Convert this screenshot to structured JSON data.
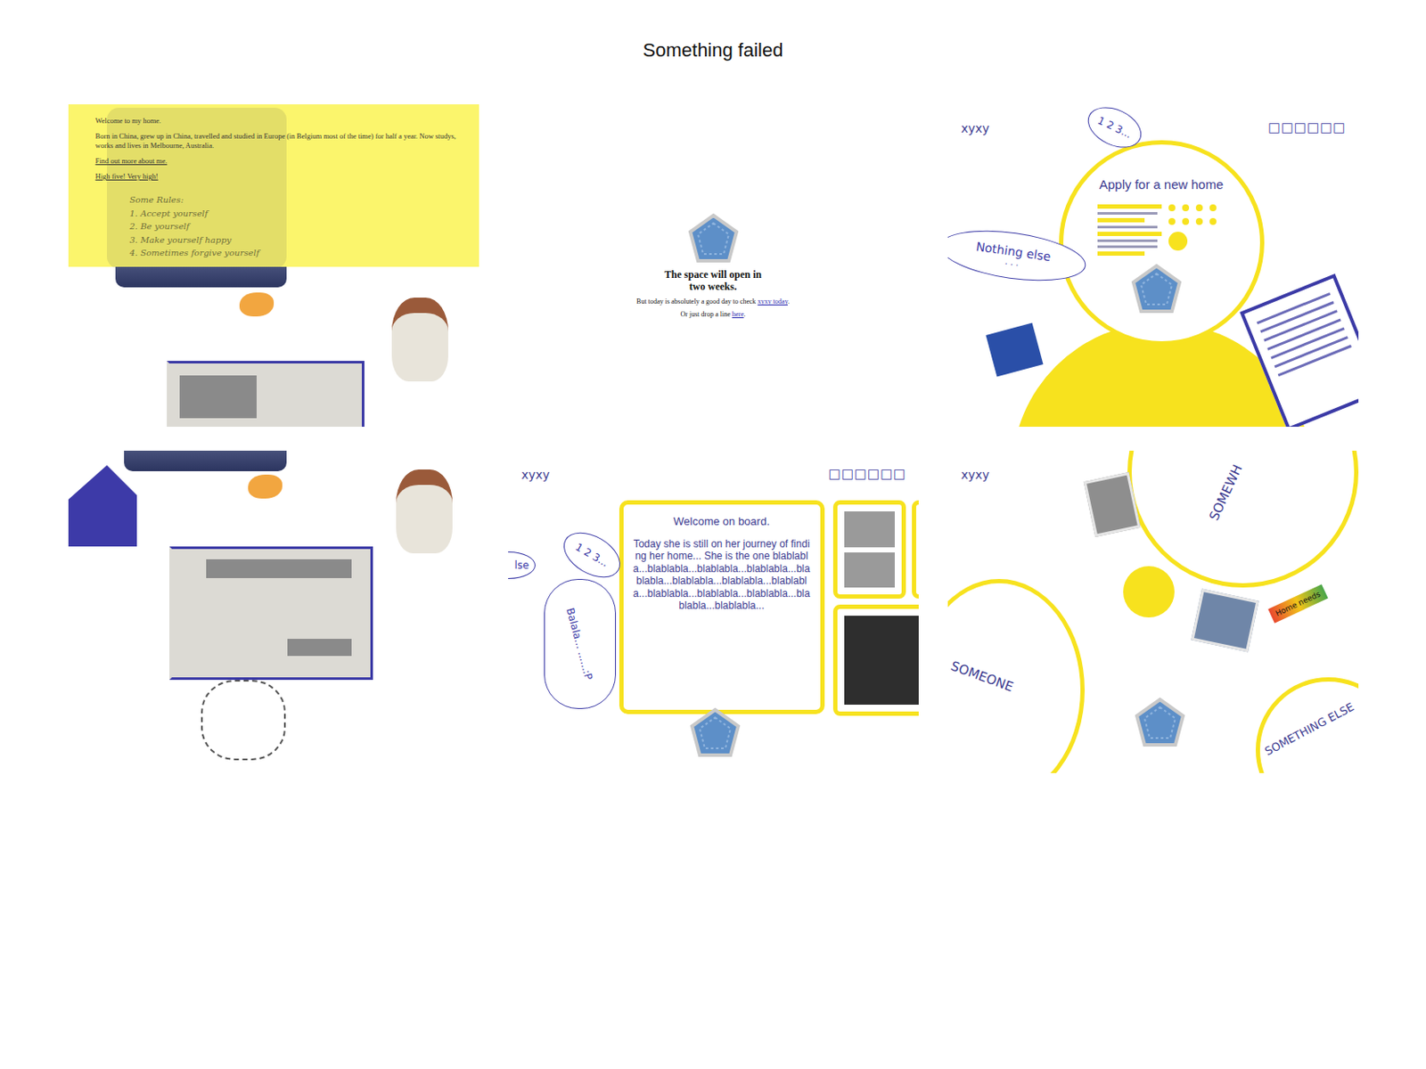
{
  "page": {
    "title": "Something failed"
  },
  "tiles": [
    {
      "kind": "intro",
      "lines": [
        "Welcome to my home.",
        "Born in China, grew up in China, travelled and studied in Europe (in Belgium most of the time) for half a year. Now studys, works and lives in Melbourne, Australia."
      ],
      "links": [
        "Find out more about me.",
        "High five! Very high!"
      ],
      "rules_title": "Some Rules:",
      "rules": [
        "1. Accept yourself",
        "2. Be yourself",
        "3. Make yourself happy",
        "4. Sometimes forgive yourself"
      ]
    },
    {
      "kind": "soon",
      "heading": "The space will open in two weeks.",
      "line_before": "But today is absolutely a good day to check ",
      "link": "xyxy today",
      "line_after": ".",
      "drop_before": "Or just drop a line ",
      "drop_link": "here",
      "drop_after": "."
    },
    {
      "kind": "apply",
      "logo": "xyxy",
      "menu": "□□□□□□",
      "bubble": "1 2 3...",
      "heading": "Apply for a new home",
      "side_bubble": "Nothing else",
      "side_dots": ". . ."
    },
    {
      "kind": "collage"
    },
    {
      "kind": "board",
      "logo": "xyxy",
      "menu": "□□□□□□",
      "bubble": "1 2 3...",
      "tall_bubble": "Balala... ......:P",
      "cut_bubble": "lse",
      "heading": "Welcome on board.",
      "body": "Today she is still on her journey of finding her home... She is the one blablabla...blablabla...blablabla...blablabla...blablabla...blablabla...blablabla...blablabla...blablabla...blablabla...blablabla...blablabla...blablabla..."
    },
    {
      "kind": "circles",
      "logo": "xyxy",
      "labels": [
        "SOMEWH",
        "SOMEONE",
        "SOMETHING ELSE"
      ],
      "tag": "Home needs"
    }
  ]
}
